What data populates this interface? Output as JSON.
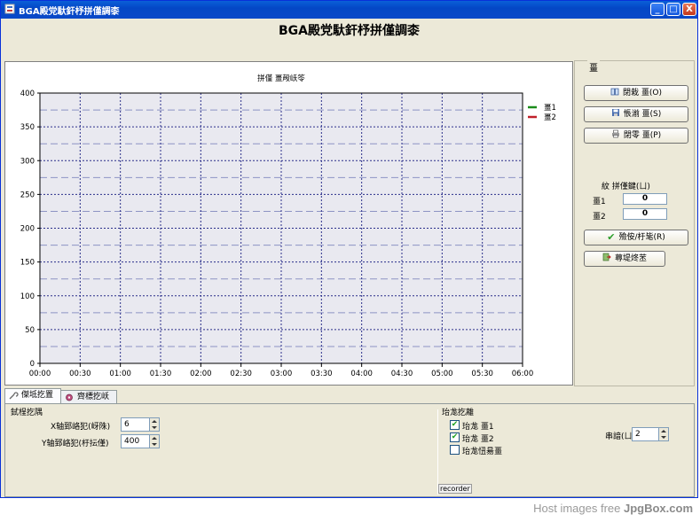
{
  "window": {
    "title": "BGA殿党馱釬杼拼僅調桼",
    "minimize_glyph": "_",
    "maximize_glyph": "□",
    "close_glyph": "X"
  },
  "header": {
    "title": "BGA殿党馱釬杼拼僅調桼"
  },
  "chart_data": {
    "type": "line",
    "title": "拼僅 畺殸岆笭",
    "x": [
      "00:00",
      "00:30",
      "01:00",
      "01:30",
      "02:00",
      "02:30",
      "03:00",
      "03:30",
      "04:00",
      "04:30",
      "05:00",
      "05:30",
      "06:00"
    ],
    "ylim": [
      0,
      400
    ],
    "yticks": [
      0,
      50,
      100,
      150,
      200,
      250,
      300,
      350,
      400
    ],
    "series": [
      {
        "name": "畺1",
        "color": "#1a8c1a",
        "values": []
      },
      {
        "name": "畺2",
        "color": "#c0202a",
        "values": []
      }
    ],
    "grid": true,
    "legend": "top-right",
    "plot_background": "#e9e9f0"
  },
  "right_panel": {
    "title": "畺",
    "buttons": [
      {
        "label": "閉栽 畺(O)",
        "icon": "open-book-icon"
      },
      {
        "label": "悵湔 畺(S)",
        "icon": "save-disk-icon"
      },
      {
        "label": "閉零 畺(P)",
        "icon": "printer-icon"
      }
    ],
    "readout_header": "紋  拼僅鍵(ㄩ)",
    "readouts": [
      {
        "label": "畺1",
        "value": "0"
      },
      {
        "label": "畺2",
        "value": "0"
      }
    ],
    "start_button": "殮侒/杅毞(R)",
    "exit_button": "蕁堤炵苤"
  },
  "tabs": [
    {
      "label": "傑坻扢置",
      "icon": "wrench-icon"
    },
    {
      "label": "齊標扢岆",
      "icon": "tool-icon"
    }
  ],
  "axis_settings": {
    "group_title": "鉽桯扢隅",
    "x_label": "X轴郅峈犯(岈陎)",
    "x_value": "6",
    "y_label": "Y轴郅峈犯(杅抎僅)",
    "y_value": "400"
  },
  "curve_settings": {
    "group_title": "珆尨扢離",
    "items": [
      {
        "label": "珆尨 畺1",
        "checked": true
      },
      {
        "label": "珆尨 畺2",
        "checked": true
      },
      {
        "label": "珆尨忸昜畺",
        "checked": false
      }
    ],
    "port_label": "串諳(ㄩ)",
    "port_value": "2"
  },
  "recorder_label": "recorder",
  "footer": {
    "prefix": "Host images free ",
    "brand": "JpgBox.com"
  }
}
